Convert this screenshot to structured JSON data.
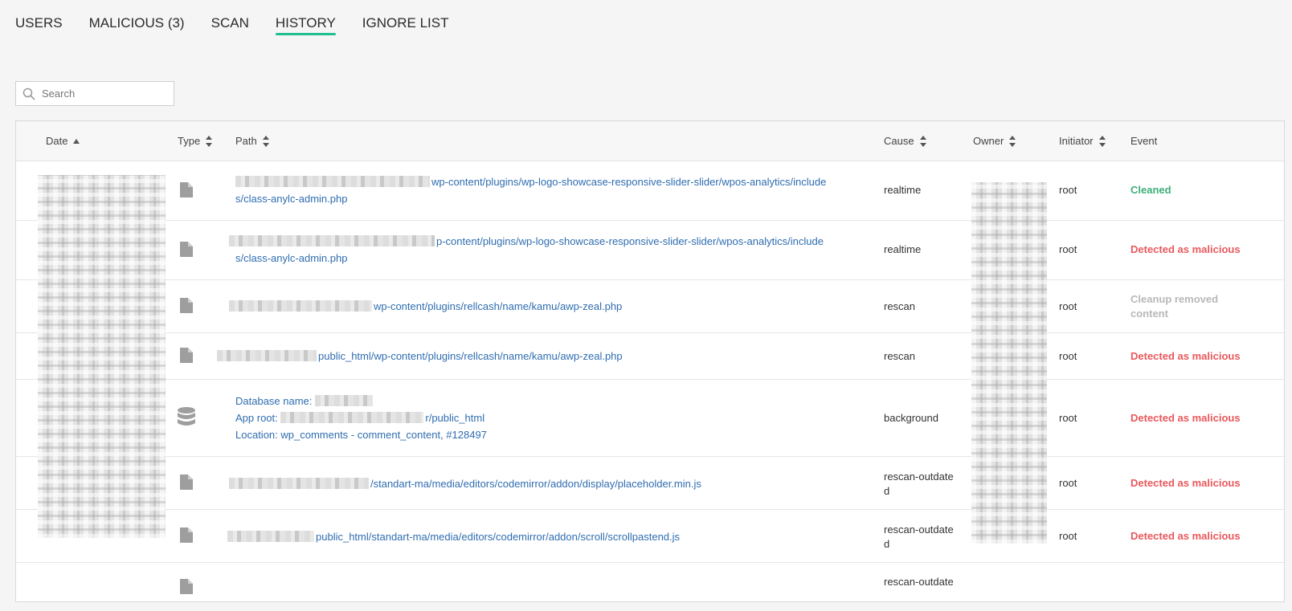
{
  "tabs": [
    {
      "label": "USERS",
      "active": false
    },
    {
      "label": "MALICIOUS (3)",
      "active": false
    },
    {
      "label": "SCAN",
      "active": false
    },
    {
      "label": "HISTORY",
      "active": true
    },
    {
      "label": "IGNORE LIST",
      "active": false
    }
  ],
  "search": {
    "placeholder": "Search",
    "value": ""
  },
  "table": {
    "columns": {
      "date": "Date",
      "type": "Type",
      "path": "Path",
      "cause": "Cause",
      "owner": "Owner",
      "initiator": "Initiator",
      "event": "Event"
    },
    "sort": {
      "column": "Date",
      "direction": "ascending"
    },
    "rows": [
      {
        "type_icon": "file-icon",
        "path_line1": "wp-content/plugins/wp-logo-showcase-responsive-slider-slider/wpos-analytics/include",
        "path_line2": "s/class-anylc-admin.php",
        "cause": "realtime",
        "initiator": "root",
        "event": "Cleaned"
      },
      {
        "type_icon": "file-icon",
        "path_line1": "p-content/plugins/wp-logo-showcase-responsive-slider-slider/wpos-analytics/include",
        "path_line2": "s/class-anylc-admin.php",
        "cause": "realtime",
        "initiator": "root",
        "event": "Detected as malicious"
      },
      {
        "type_icon": "file-icon",
        "path_line1": "wp-content/plugins/rellcash/name/kamu/awp-zeal.php",
        "cause": "rescan",
        "initiator": "root",
        "event_line1": "Cleanup removed",
        "event_line2": "content"
      },
      {
        "type_icon": "file-icon",
        "path_line1": "public_html/wp-content/plugins/rellcash/name/kamu/awp-zeal.php",
        "cause": "rescan",
        "initiator": "root",
        "event": "Detected as malicious"
      },
      {
        "type_icon": "database-icon",
        "db_name": "Database name:",
        "app_root_label": "App root:",
        "app_root_value": "r/public_html",
        "location": "Location: wp_comments - comment_content, #128497",
        "cause": "background",
        "initiator": "root",
        "event": "Detected as malicious"
      },
      {
        "type_icon": "file-icon",
        "path_line1": "/standart-ma/media/editors/codemirror/addon/display/placeholder.min.js",
        "cause_line1": "rescan-outdate",
        "cause_line2": "d",
        "initiator": "root",
        "event": "Detected as malicious"
      },
      {
        "type_icon": "file-icon",
        "path_line1": "public_html/standart-ma/media/editors/codemirror/addon/scroll/scrollpastend.js",
        "cause_line1": "rescan-outdate",
        "cause_line2": "d",
        "initiator": "root",
        "event": "Detected as malicious"
      },
      {
        "type_icon": "file-icon",
        "cause_line1": "rescan-outdate"
      }
    ]
  },
  "colors": {
    "accent": "#1fbf8f",
    "link": "#2f6db0",
    "danger": "#e9585c",
    "success": "#3daf7a",
    "muted": "#b8b8b8"
  }
}
